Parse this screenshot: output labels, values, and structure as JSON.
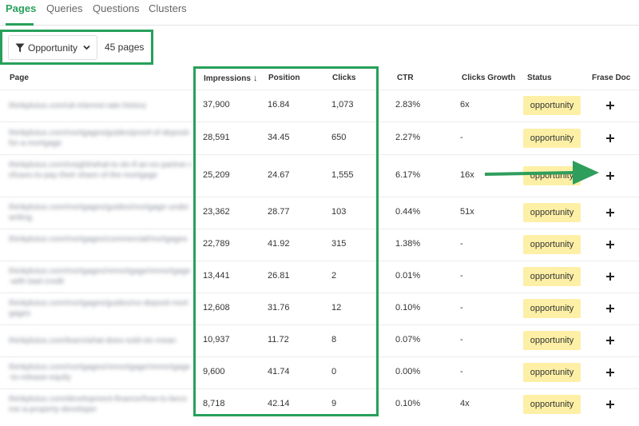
{
  "tabs": [
    {
      "label": "Pages",
      "active": true
    },
    {
      "label": "Queries",
      "active": false
    },
    {
      "label": "Questions",
      "active": false
    },
    {
      "label": "Clusters",
      "active": false
    }
  ],
  "filter": {
    "label": "Opportunity",
    "count_label": "45 pages",
    "icon": "filter-icon"
  },
  "table": {
    "columns": [
      "Page",
      "Impressions",
      "Position",
      "Clicks",
      "CTR",
      "Clicks Growth",
      "Status",
      "Frase Doc"
    ],
    "sort_indicator": "↓",
    "rows": [
      {
        "page": "thinkplutus.com/uk-interest-rate-history",
        "impressions": "37,900",
        "position": "16.84",
        "clicks": "1,073",
        "ctr": "2.83%",
        "growth": "6x",
        "status": "opportunity"
      },
      {
        "page": "thinkplutus.com/mortgages/guides/proof-of-deposit-for-a-mortgage",
        "impressions": "28,591",
        "position": "34.45",
        "clicks": "650",
        "ctr": "2.27%",
        "growth": "-",
        "status": "opportunity"
      },
      {
        "page": "thinkplutus.com/insight/what-to-do-if-an-ex-partner-refuses-to-pay-their-share-of-the-mortgage",
        "impressions": "25,209",
        "position": "24.67",
        "clicks": "1,555",
        "ctr": "6.17%",
        "growth": "16x",
        "status": "opportunity"
      },
      {
        "page": "thinkplutus.com/mortgages/guides/mortgage-underwriting",
        "impressions": "23,362",
        "position": "28.77",
        "clicks": "103",
        "ctr": "0.44%",
        "growth": "51x",
        "status": "opportunity"
      },
      {
        "page": "thinkplutus.com/mortgages/commercial/mortgages",
        "impressions": "22,789",
        "position": "41.92",
        "clicks": "315",
        "ctr": "1.38%",
        "growth": "-",
        "status": "opportunity"
      },
      {
        "page": "thinkplutus.com/mortgages/remortgage/remortgage-with-bad-credit",
        "impressions": "13,441",
        "position": "26.81",
        "clicks": "2",
        "ctr": "0.01%",
        "growth": "-",
        "status": "opportunity"
      },
      {
        "page": "thinkplutus.com/mortgages/guides/no-deposit-mortgages",
        "impressions": "12,608",
        "position": "31.76",
        "clicks": "12",
        "ctr": "0.10%",
        "growth": "-",
        "status": "opportunity"
      },
      {
        "page": "thinkplutus.com/learn/what-does-sold-stc-mean",
        "impressions": "10,937",
        "position": "11.72",
        "clicks": "8",
        "ctr": "0.07%",
        "growth": "-",
        "status": "opportunity"
      },
      {
        "page": "thinkplutus.com/mortgages/remortgage/remortgage-to-release-equity",
        "impressions": "9,600",
        "position": "41.74",
        "clicks": "0",
        "ctr": "0.00%",
        "growth": "-",
        "status": "opportunity"
      },
      {
        "page": "thinkplutus.com/development-finance/how-to-become-a-property-developer",
        "impressions": "8,718",
        "position": "42.14",
        "clicks": "9",
        "ctr": "0.10%",
        "growth": "4x",
        "status": "opportunity"
      }
    ]
  },
  "colors": {
    "accent": "#27a05a",
    "status_bg": "#fdf0a6",
    "annotation_arrow": "#2e9e5c"
  }
}
